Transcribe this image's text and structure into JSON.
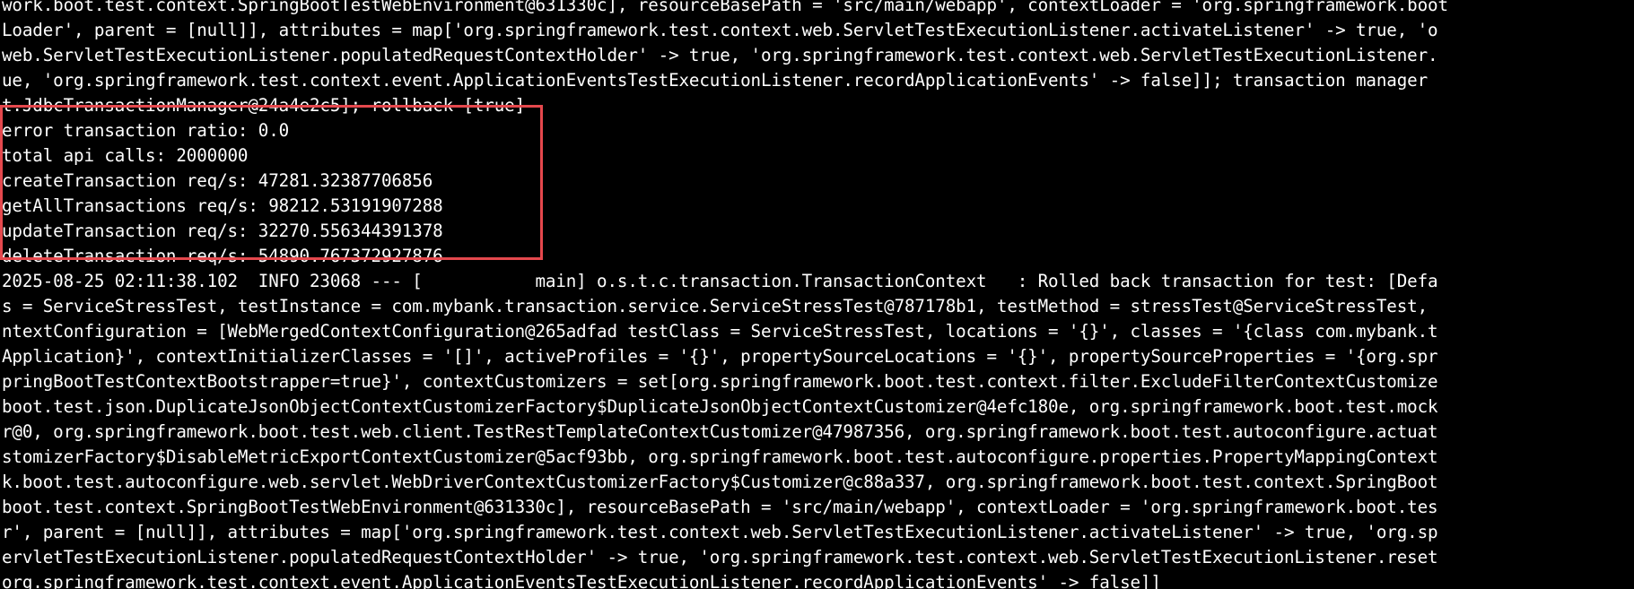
{
  "terminal": {
    "lines_top": [
      "work.boot.test.context.SpringBootTestWebEnvironment@631330c], resourceBasePath = 'src/main/webapp', contextLoader = 'org.springframework.boot",
      "Loader', parent = [null]], attributes = map['org.springframework.test.context.web.ServletTestExecutionListener.activateListener' -> true, 'o",
      "web.ServletTestExecutionListener.populatedRequestContextHolder' -> true, 'org.springframework.test.context.web.ServletTestExecutionListener.",
      "ue, 'org.springframework.test.context.event.ApplicationEventsTestExecutionListener.recordApplicationEvents' -> false]]; transaction manager",
      "t.JdbcTransactionManager@24a4e2c5]; rollback [true]"
    ],
    "stats": [
      "error transaction ratio: 0.0",
      "total api calls: 2000000",
      "createTransaction req/s: 47281.32387706856",
      "getAllTransactions req/s: 98212.53191907288",
      "updateTransaction req/s: 32270.556344391378",
      "deleteTransaction req/s: 54890.767372927876"
    ],
    "lines_bottom": [
      "2025-08-25 02:11:38.102  INFO 23068 --- [           main] o.s.t.c.transaction.TransactionContext   : Rolled back transaction for test: [Defa",
      "s = ServiceStressTest, testInstance = com.mybank.transaction.service.ServiceStressTest@787178b1, testMethod = stressTest@ServiceStressTest,",
      "ntextConfiguration = [WebMergedContextConfiguration@265adfad testClass = ServiceStressTest, locations = '{}', classes = '{class com.mybank.t",
      "Application}', contextInitializerClasses = '[]', activeProfiles = '{}', propertySourceLocations = '{}', propertySourceProperties = '{org.spr",
      "pringBootTestContextBootstrapper=true}', contextCustomizers = set[org.springframework.boot.test.context.filter.ExcludeFilterContextCustomize",
      "boot.test.json.DuplicateJsonObjectContextCustomizerFactory$DuplicateJsonObjectContextCustomizer@4efc180e, org.springframework.boot.test.mock",
      "r@0, org.springframework.boot.test.web.client.TestRestTemplateContextCustomizer@47987356, org.springframework.boot.test.autoconfigure.actuat",
      "stomizerFactory$DisableMetricExportContextCustomizer@5acf93bb, org.springframework.boot.test.autoconfigure.properties.PropertyMappingContext",
      "k.boot.test.autoconfigure.web.servlet.WebDriverContextCustomizerFactory$Customizer@c88a337, org.springframework.boot.test.context.SpringBoot",
      "boot.test.context.SpringBootTestWebEnvironment@631330c], resourceBasePath = 'src/main/webapp', contextLoader = 'org.springframework.boot.tes",
      "r', parent = [null]], attributes = map['org.springframework.test.context.web.ServletTestExecutionListener.activateListener' -> true, 'org.sp",
      "ervletTestExecutionListener.populatedRequestContextHolder' -> true, 'org.springframework.test.context.web.ServletTestExecutionListener.reset",
      "org.springframework.test.context.event.ApplicationEventsTestExecutionListener.recordApplicationEvents' -> false]]"
    ]
  },
  "colors": {
    "background": "#000000",
    "text": "#ffffff",
    "highlight_border": "#e5484d"
  }
}
